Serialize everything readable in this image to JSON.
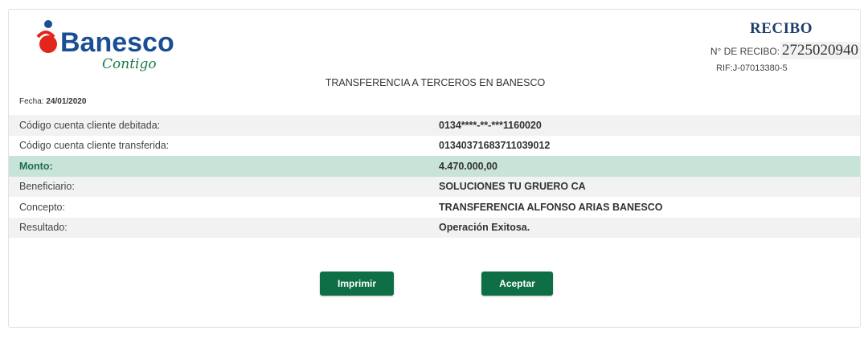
{
  "brand": {
    "name": "Banesco",
    "tagline": "Contigo",
    "accent": "#0e6e45",
    "logo_red": "#e2261c",
    "logo_blue": "#1b4f93"
  },
  "header": {
    "recibo_title": "RECIBO",
    "recibo_label": "N° DE RECIBO:",
    "recibo_number": "2725020940",
    "rif": "RIF:J-07013380-5",
    "title": "TRANSFERENCIA A TERCEROS EN BANESCO",
    "fecha_label": "Fecha:",
    "fecha_value": "24/01/2020"
  },
  "rows": [
    {
      "label": "Código cuenta cliente debitada:",
      "value": "0134****-**-***1160020"
    },
    {
      "label": "Código cuenta cliente transferida:",
      "value": "01340371683711039012"
    },
    {
      "label": "Monto:",
      "value": "4.470.000,00"
    },
    {
      "label": "Beneficiario:",
      "value": "SOLUCIONES TU GRUERO CA"
    },
    {
      "label": "Concepto:",
      "value": "TRANSFERENCIA ALFONSO ARIAS BANESCO"
    },
    {
      "label": "Resultado:",
      "value": "Operación Exitosa."
    }
  ],
  "buttons": {
    "print": "Imprimir",
    "accept": "Aceptar"
  }
}
